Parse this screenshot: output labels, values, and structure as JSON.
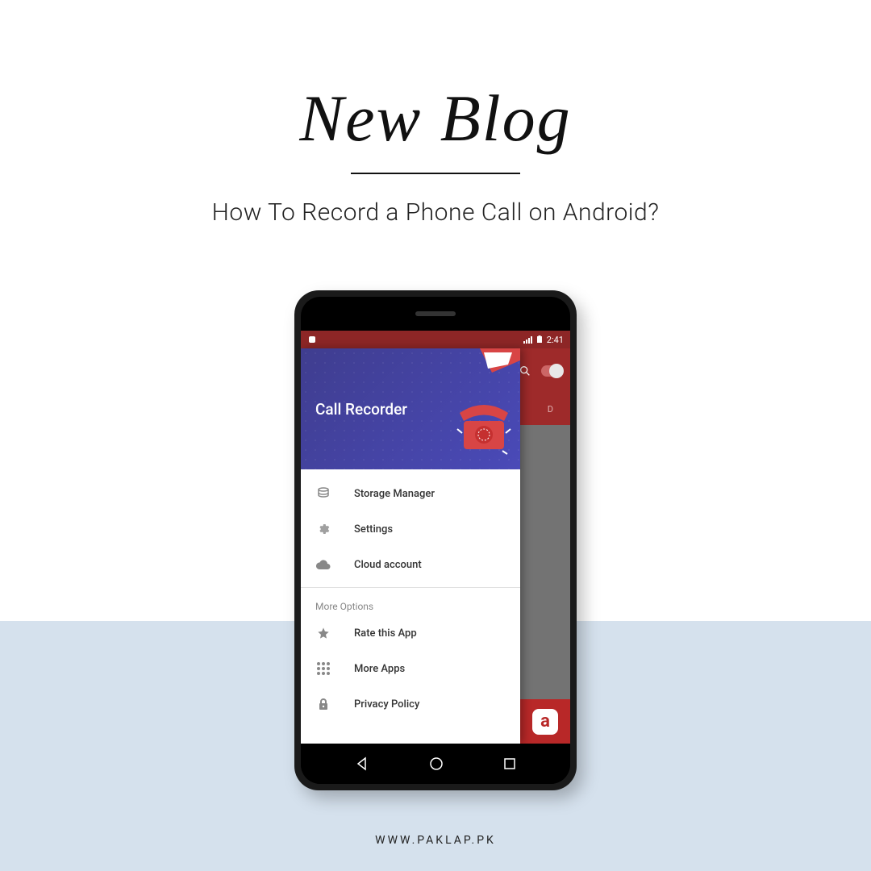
{
  "header": {
    "script_title": "New Blog",
    "subtitle": "How To Record a Phone Call on Android?"
  },
  "footer": {
    "url": "WWW.PAKLAP.PK"
  },
  "phone": {
    "status_time": "2:41",
    "app_drawer_title": "Call Recorder",
    "tab_visible": "D",
    "menu_items": [
      {
        "label": "Storage Manager",
        "icon": "storage"
      },
      {
        "label": "Settings",
        "icon": "gear"
      },
      {
        "label": "Cloud account",
        "icon": "cloud"
      }
    ],
    "more_section_label": "More Options",
    "more_items": [
      {
        "label": "Rate this App",
        "icon": "star"
      },
      {
        "label": "More Apps",
        "icon": "apps"
      },
      {
        "label": "Privacy Policy",
        "icon": "lock"
      }
    ],
    "ad_logo": "a"
  }
}
